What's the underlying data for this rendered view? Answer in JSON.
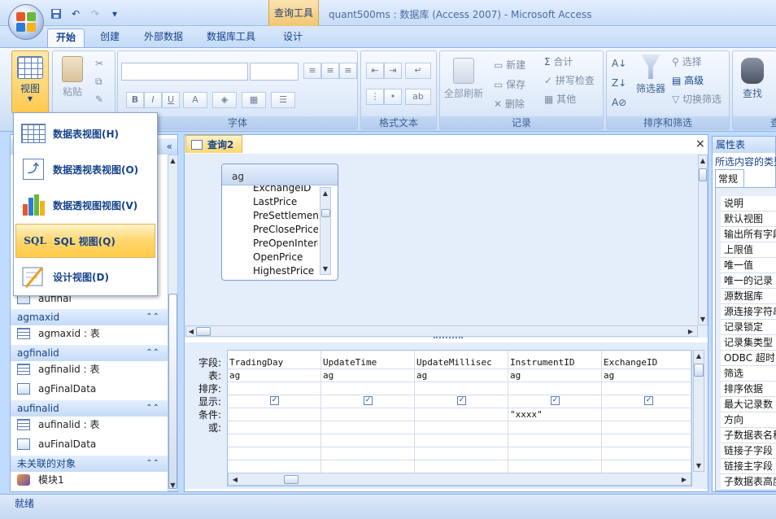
{
  "window": {
    "title": "quant500ms : 数据库 (Access 2007) - Microsoft Access",
    "context_tab": "查询工具"
  },
  "qat": {
    "save_icon": "save-icon",
    "undo_icon": "undo-icon",
    "redo_icon": "redo-icon",
    "customize": "▾"
  },
  "tabs": [
    {
      "label": "开始",
      "active": true
    },
    {
      "label": "创建"
    },
    {
      "label": "外部数据"
    },
    {
      "label": "数据库工具"
    },
    {
      "label": "设计"
    }
  ],
  "ribbon": {
    "view_label": "视图",
    "paste_label": "粘贴",
    "font_group": "字体",
    "rich_text_group": "格式文本",
    "records_group": "记录",
    "sort_filter_group": "排序和筛选",
    "find_group": "查",
    "refresh_label": "全部刷新",
    "new_label": "新建",
    "save_label": "保存",
    "delete_label": "删除",
    "totals_label": "合计",
    "spelling_label": "拼写检查",
    "more_label": "其他",
    "filter_label": "筛选器",
    "selection_label": "选择",
    "advanced_label": "高级",
    "toggle_filter_label": "切换筛选",
    "find_label": "查找",
    "bold": "B",
    "italic": "I",
    "underline": "U"
  },
  "view_menu": {
    "items": [
      {
        "label": "数据表视图(H)",
        "icon": "datasheet-icon"
      },
      {
        "label": "数据透视表视图(O)",
        "icon": "pivot-table-icon"
      },
      {
        "label": "数据透视图视图(V)",
        "icon": "pivot-chart-icon"
      },
      {
        "label": "SQL 视图(Q)",
        "icon": "sql-icon",
        "prefix": "SQL",
        "highlighted": true
      },
      {
        "label": "设计视图(D)",
        "icon": "design-icon"
      }
    ]
  },
  "nav": {
    "collapse": "«",
    "partial_item": "aufinal",
    "groups": [
      {
        "title": "agmaxid",
        "items": [
          {
            "label": "agmaxid : 表",
            "icon": "table-icon"
          }
        ]
      },
      {
        "title": "agfinalid",
        "items": [
          {
            "label": "agfinalid : 表",
            "icon": "table-icon"
          },
          {
            "label": "agFinalData",
            "icon": "query-icon"
          }
        ]
      },
      {
        "title": "aufinalid",
        "items": [
          {
            "label": "aufinalid : 表",
            "icon": "table-icon"
          },
          {
            "label": "auFinalData",
            "icon": "query-icon"
          }
        ]
      },
      {
        "title": "未关联的对象",
        "items": [
          {
            "label": "模块1",
            "icon": "module-icon"
          }
        ]
      }
    ]
  },
  "document": {
    "tab_label": "查询2",
    "close": "×",
    "table": {
      "name": "ag",
      "fields": [
        "ExchangeID",
        "LastPrice",
        "PreSettlement",
        "PreClosePrice",
        "PreOpenInterest",
        "OpenPrice",
        "HighestPrice"
      ]
    },
    "grid": {
      "row_labels": [
        "字段:",
        "表:",
        "排序:",
        "显示:",
        "条件:",
        "或:"
      ],
      "columns": [
        {
          "field": "TradingDay",
          "table": "ag",
          "show": true,
          "criteria": ""
        },
        {
          "field": "UpdateTime",
          "table": "ag",
          "show": true,
          "criteria": ""
        },
        {
          "field": "UpdateMillisec",
          "table": "ag",
          "show": true,
          "criteria": ""
        },
        {
          "field": "InstrumentID",
          "table": "ag",
          "show": true,
          "criteria": "\"xxxx\""
        },
        {
          "field": "ExchangeID",
          "table": "ag",
          "show": true,
          "criteria": ""
        }
      ]
    }
  },
  "properties": {
    "title": "属性表",
    "subtitle": "所选内容的类型",
    "tab": "常规",
    "rows": [
      "说明",
      "默认视图",
      "输出所有字段",
      "上限值",
      "唯一值",
      "唯一的记录",
      "源数据库",
      "源连接字符串",
      "记录锁定",
      "记录集类型",
      "ODBC 超时",
      "筛选",
      "排序依据",
      "最大记录数",
      "方向",
      "子数据表名称",
      "链接子字段",
      "链接主字段",
      "子数据表高度"
    ]
  },
  "status": {
    "text": "就绪"
  },
  "colors": {
    "accent": "#15428b",
    "highlight": "#ffd66e",
    "ribbon": "#dbe8fa"
  }
}
